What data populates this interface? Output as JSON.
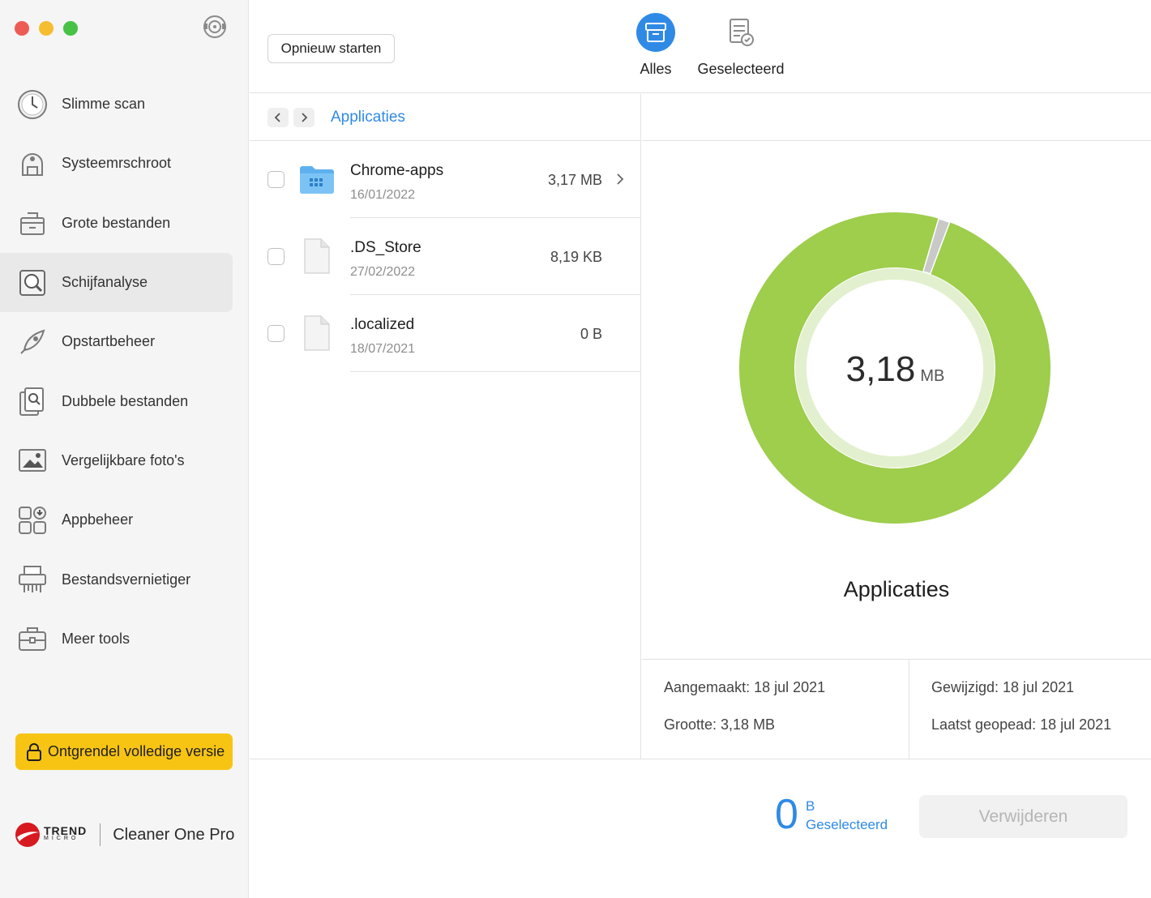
{
  "sidebar": {
    "items": [
      {
        "label": "Slimme scan",
        "icon": "clock-icon"
      },
      {
        "label": "Systeemrschroot",
        "icon": "vacuum-icon"
      },
      {
        "label": "Grote bestanden",
        "icon": "box-icon"
      },
      {
        "label": "Schijfanalyse",
        "icon": "disk-search-icon"
      },
      {
        "label": "Opstartbeheer",
        "icon": "rocket-icon"
      },
      {
        "label": "Dubbele bestanden",
        "icon": "duplicate-files-icon"
      },
      {
        "label": "Vergelijkbare foto's",
        "icon": "photo-icon"
      },
      {
        "label": "Appbeheer",
        "icon": "apps-icon"
      },
      {
        "label": "Bestandsvernietiger",
        "icon": "shredder-icon"
      },
      {
        "label": "Meer tools",
        "icon": "toolbox-icon"
      }
    ],
    "active_index": 3,
    "unlock_label": "Ontgrendel volledige versie",
    "brand": {
      "trend": "TREND",
      "micro": "MICRO",
      "product": "Cleaner One Pro"
    }
  },
  "toolbar": {
    "restart_label": "Opnieuw starten",
    "segments": {
      "all": "Alles",
      "selected": "Geselecteerd"
    }
  },
  "browser": {
    "breadcrumb": "Applicaties",
    "files": [
      {
        "name": "Chrome-apps",
        "date": "16/01/2022",
        "size": "3,17 MB",
        "type": "folder",
        "has_children": true
      },
      {
        "name": ".DS_Store",
        "date": "27/02/2022",
        "size": "8,19 KB",
        "type": "file",
        "has_children": false
      },
      {
        "name": ".localized",
        "date": "18/07/2021",
        "size": "0 B",
        "type": "file",
        "has_children": false
      }
    ]
  },
  "detail": {
    "total_value": "3,18",
    "total_unit": "MB",
    "name": "Applicaties",
    "created": "Aangemaakt: 18 jul 2021",
    "modified": "Gewijzigd: 18 jul 2021",
    "size": "Grootte: 3,18 MB",
    "last_opened": "Laatst geopead: 18 jul 2021"
  },
  "chart_data": {
    "type": "pie",
    "variant": "donut",
    "segments": [
      {
        "name": "Chrome-apps",
        "value": 3.17,
        "unit": "MB",
        "color": "#9fcd4c"
      },
      {
        "name": ".DS_Store",
        "value": 0.00819,
        "unit": "MB",
        "color": "#c9c9c9"
      },
      {
        "name": ".localized",
        "value": 0,
        "unit": "MB",
        "color": "#9fcd4c"
      }
    ],
    "total": "3,18 MB"
  },
  "footer": {
    "selected_value": "0",
    "selected_unit": "B",
    "selected_label": "Geselecteerd",
    "delete_label": "Verwijderen"
  },
  "colors": {
    "accent_blue": "#2f8ae6",
    "unlock_yellow": "#f7c414",
    "chart_green": "#9fcd4c",
    "chart_inner_ring": "#e3f0cf"
  }
}
